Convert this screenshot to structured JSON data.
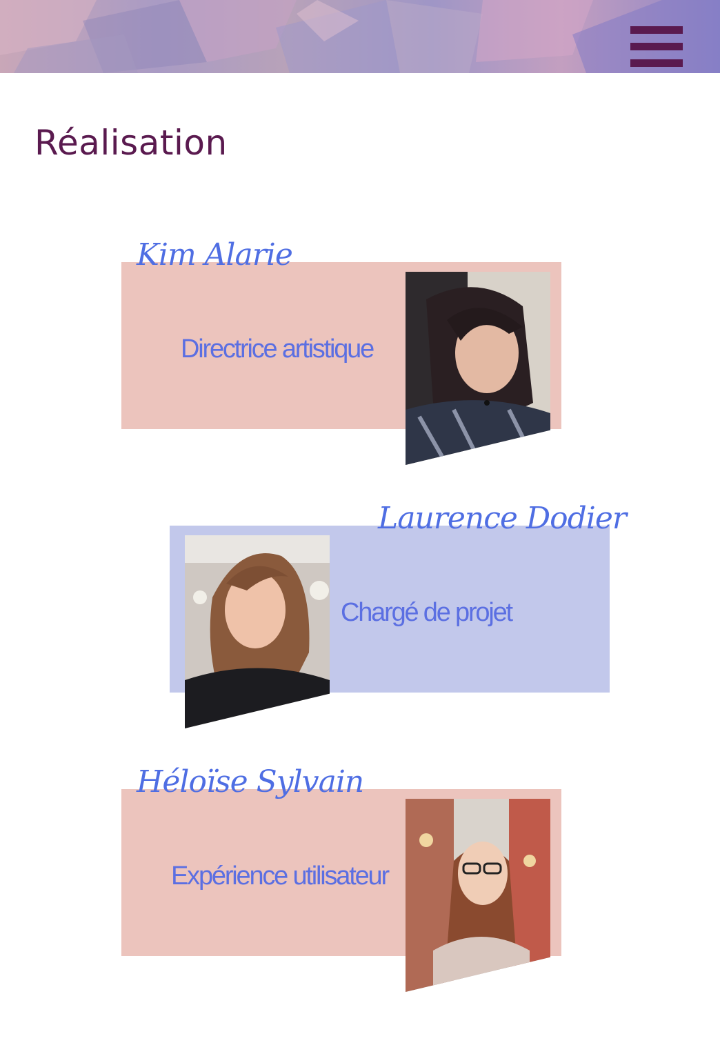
{
  "header": {
    "menu_icon": "hamburger-menu-icon",
    "accent_color": "#5a1a4f"
  },
  "page": {
    "title": "Réalisation"
  },
  "team": [
    {
      "name": "Kim Alarie",
      "role": "Directrice artistique",
      "card_color": "#ecc4bd"
    },
    {
      "name": "Laurence Dodier",
      "role": "Chargé de projet",
      "card_color": "#c2c8eb"
    },
    {
      "name": "Héloïse Sylvain",
      "role": "Expérience utilisateur",
      "card_color": "#ecc4bd"
    }
  ]
}
